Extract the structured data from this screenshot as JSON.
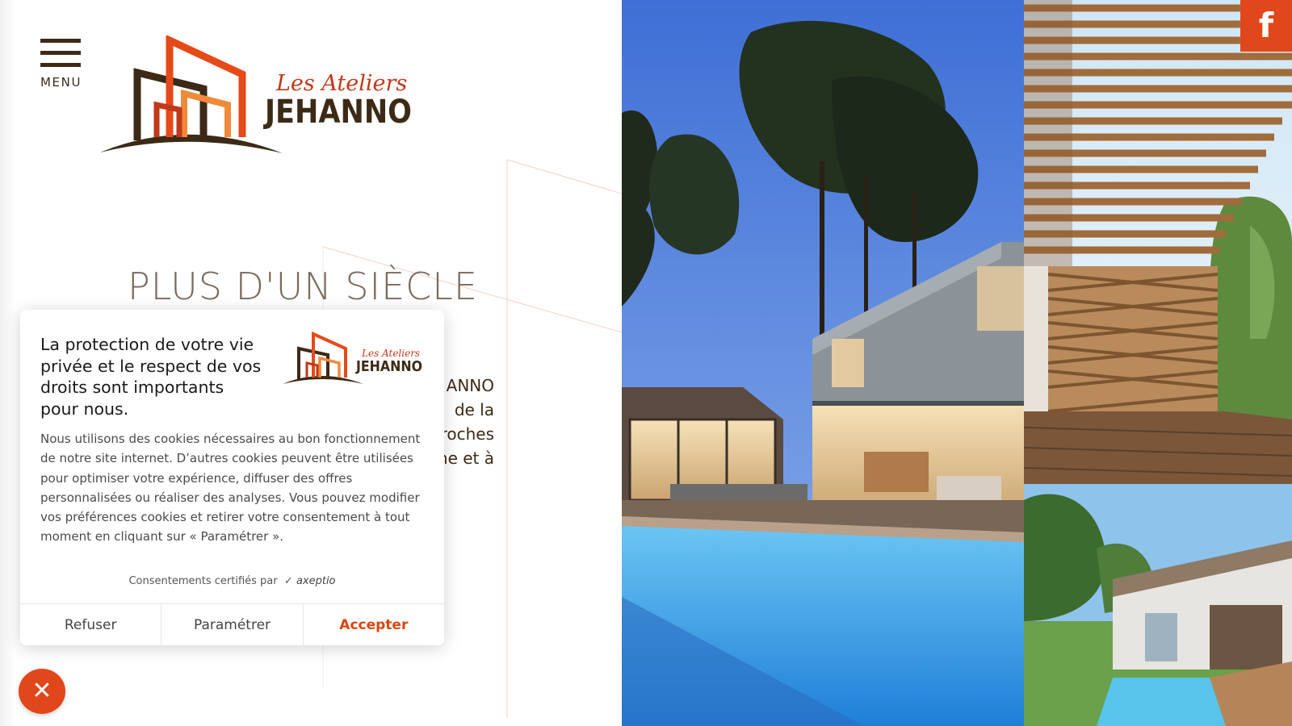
{
  "header": {
    "menu_label": "MENU",
    "logo_text_top": "Les Ateliers",
    "logo_text_bottom": "JEHANNO"
  },
  "hero": {
    "title": "PLUS D'UN SIÈCLE",
    "body_fragments": [
      "ANNO",
      "de    la",
      "roches",
      "ne et à"
    ]
  },
  "social": {
    "facebook_icon": "facebook-icon",
    "facebook_glyph": "f"
  },
  "cookie_banner": {
    "title": "La protection de votre vie privée et le respect de vos droits sont importants pour nous.",
    "logo_text_top": "Les Ateliers",
    "logo_text_bottom": "JEHANNO",
    "body": "Nous utilisons des cookies nécessaires au bon fonctionnement de notre site internet. D’autres cookies peuvent être utilisées pour optimiser votre expérience, diffuser des offres personnalisées ou réaliser des analyses. Vous pouvez modifier vos préférences cookies et retirer votre consentement à tout moment en cliquant sur « Paramétrer ».",
    "certified_label": "Consentements certifiés par",
    "certified_brand": "axeptio",
    "buttons": {
      "refuse": "Refuser",
      "settings": "Paramétrer",
      "accept": "Accepter"
    }
  },
  "close_fab": {
    "glyph": "✕"
  },
  "colors": {
    "brand_orange": "#e0471a",
    "brand_brown": "#3d2a16",
    "accent_text": "#d9460f"
  }
}
